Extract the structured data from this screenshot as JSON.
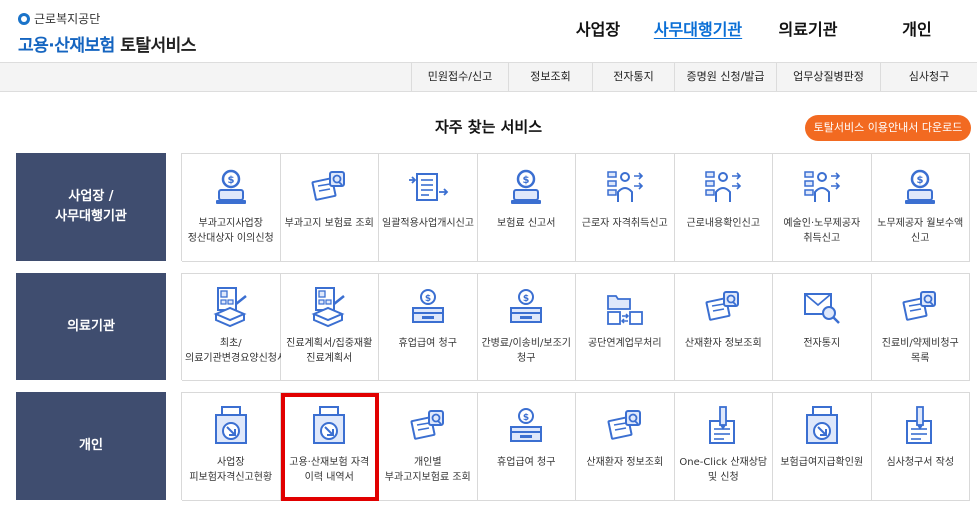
{
  "logo": {
    "org": "근로복지공단",
    "title_part1": "고용·산재보험",
    "title_part2": "토탈서비스"
  },
  "gnb": [
    {
      "label": "사업장",
      "active": false
    },
    {
      "label": "사무대행기관",
      "active": true
    },
    {
      "label": "의료기관",
      "active": false
    },
    {
      "label": "개인",
      "active": false
    }
  ],
  "subnav": [
    "민원접수/신고",
    "정보조회",
    "전자통지",
    "증명원 신청/발급",
    "업무상질병판정",
    "심사청구"
  ],
  "section": {
    "title": "자주 찾는 서비스",
    "download_button": "토탈서비스 이용안내서 다운로드"
  },
  "colors": {
    "accent_blue": "#0a6fd6",
    "row_label_bg": "#3f4d6f",
    "orange": "#f26a21",
    "highlight": "#e10000",
    "icon_blue": "#3b6fd1"
  },
  "rows": [
    {
      "label": "사업장 /\n사무대행기관",
      "items": [
        {
          "label": "부과고지사업장 정산대상자 이의신청",
          "icon": "money-hand-icon"
        },
        {
          "label": "부과고지 보험료 조회",
          "icon": "document-search-icon"
        },
        {
          "label": "일괄적용사업개시신고",
          "icon": "document-transfer-icon"
        },
        {
          "label": "보험료 신고서",
          "icon": "money-hand-icon"
        },
        {
          "label": "근로자 자격취득신고",
          "icon": "worker-list-icon"
        },
        {
          "label": "근로내용확인신고",
          "icon": "worker-list-icon"
        },
        {
          "label": "예술인·노무제공자 취득신고",
          "icon": "worker-list-icon"
        },
        {
          "label": "노무제공자 월보수액 신고",
          "icon": "money-hand-icon"
        }
      ]
    },
    {
      "label": "의료기관",
      "items": [
        {
          "label": "최초/의료기관변경요양신청서",
          "icon": "hospital-document-icon"
        },
        {
          "label": "진료계획서/집중재활 진료계획서",
          "icon": "hospital-document-icon"
        },
        {
          "label": "휴업급여 청구",
          "icon": "money-box-icon"
        },
        {
          "label": "간병료/이송비/보조기 청구",
          "icon": "money-box-icon"
        },
        {
          "label": "공단연계업무처리",
          "icon": "folder-exchange-icon"
        },
        {
          "label": "산재환자 정보조회",
          "icon": "document-search-icon"
        },
        {
          "label": "전자통지",
          "icon": "mail-search-icon"
        },
        {
          "label": "진료비/약제비청구 목록",
          "icon": "document-search-icon"
        }
      ]
    },
    {
      "label": "개인",
      "items": [
        {
          "label": "사업장 피보험자격신고현황",
          "icon": "download-box-icon"
        },
        {
          "label": "고용·산재보험 자격 이력 내역서",
          "icon": "download-box-icon",
          "highlight": true
        },
        {
          "label": "개인별 부과고지보험료 조회",
          "icon": "document-search-icon"
        },
        {
          "label": "휴업급여 청구",
          "icon": "money-box-icon"
        },
        {
          "label": "산재환자 정보조회",
          "icon": "document-search-icon"
        },
        {
          "label": "One-Click 산재상담 및 신청",
          "icon": "pen-document-icon"
        },
        {
          "label": "보험급여지급확인원",
          "icon": "download-box-icon"
        },
        {
          "label": "심사청구서 작성",
          "icon": "pen-document-icon"
        }
      ]
    }
  ]
}
